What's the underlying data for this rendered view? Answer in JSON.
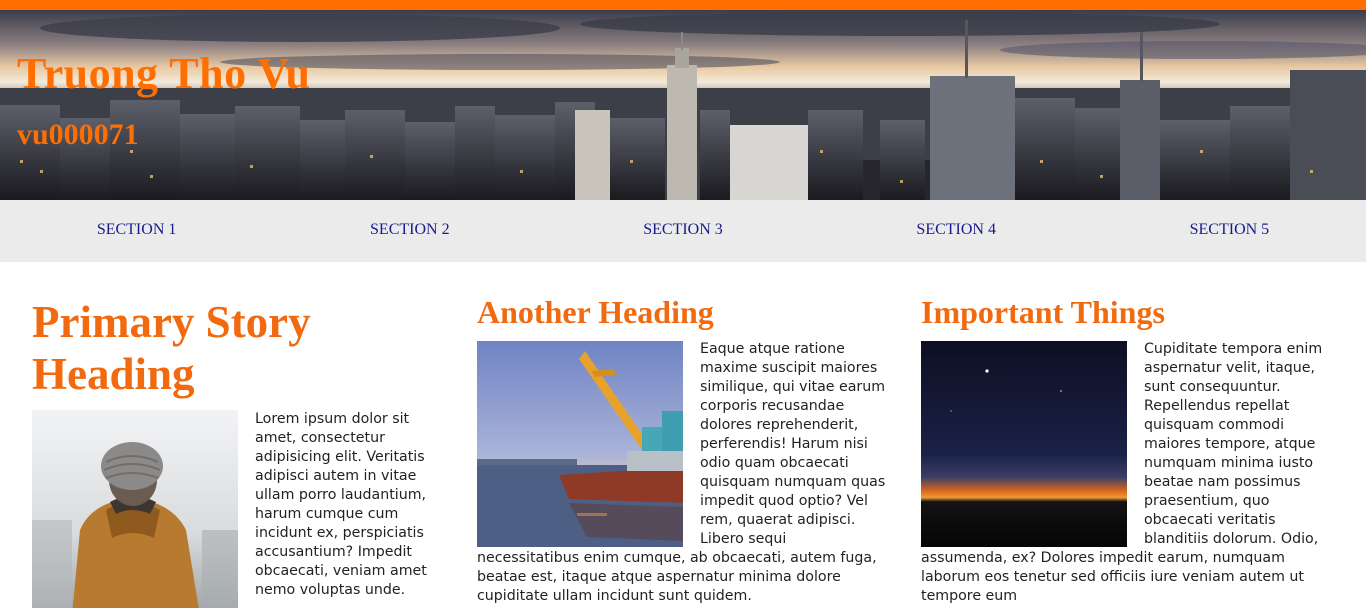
{
  "header": {
    "title": "Truong Tho Vu",
    "subtitle": "vu000071"
  },
  "nav": {
    "items": [
      {
        "label": "SECTION 1"
      },
      {
        "label": "SECTION 2"
      },
      {
        "label": "SECTION 3"
      },
      {
        "label": "SECTION 4"
      },
      {
        "label": "SECTION 5"
      }
    ]
  },
  "articles": [
    {
      "heading": "Primary Story Heading",
      "image": "person-in-beanie-image",
      "text": "Lorem ipsum dolor sit amet, consectetur adipisicing elit. Veritatis adipisci autem in vitae ullam porro laudantium, harum cumque cum incidunt ex, perspiciatis accusantium? Impedit obcaecati, veniam amet nemo voluptas unde."
    },
    {
      "heading": "Another Heading",
      "image": "crane-ship-image",
      "text": "Eaque atque ratione maxime suscipit maiores similique, qui vitae earum corporis recusandae dolores reprehenderit, perferendis! Harum nisi odio quam obcaecati quisquam numquam quas impedit quod optio? Vel rem, quaerat adipisci. Libero sequi necessitatibus enim cumque, ab obcaecati, autem fuga, beatae est, itaque atque aspernatur minima dolore cupiditate ullam incidunt sunt quidem."
    },
    {
      "heading": "Important Things",
      "image": "night-horizon-image",
      "text": "Cupiditate tempora enim aspernatur velit, itaque, sunt consequuntur. Repellendus repellat quisquam commodi maiores tempore, atque numquam minima iusto beatae nam possimus praesentium, quo obcaecati veritatis blanditiis dolorum. Odio, assumenda, ex? Dolores impedit earum, numquam laborum eos tenetur sed officiis iure veniam autem ut tempore eum"
    }
  ],
  "colors": {
    "accent": "#ff6e00",
    "heading": "#f26a0f",
    "nav_bg": "#ebebeb",
    "nav_link": "#1a1a8c"
  }
}
